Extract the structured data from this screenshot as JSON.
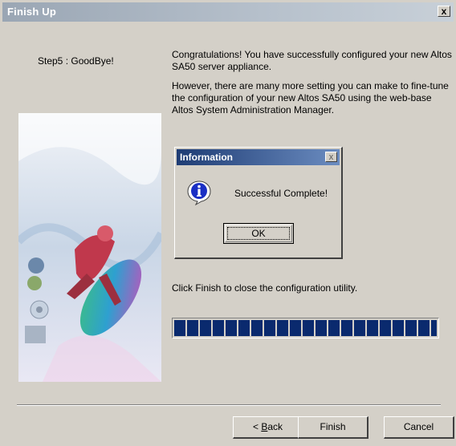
{
  "window": {
    "title": "Finish Up",
    "close_label": "x"
  },
  "wizard": {
    "step_label": "Step5 : GoodBye!",
    "paragraph1": "Congratulations! You have successfully configured your new Altos SA50 server appliance.",
    "paragraph2": "However, there are many more setting you can make to fine-tune the configuration of your new Altos SA50 using the web-base Altos System Administration Manager.",
    "finish_hint": "Click Finish to close the configuration utility.",
    "progress_fraction": 1.0
  },
  "dialog": {
    "title": "Information",
    "close_label": "x",
    "message": "Successful Complete!",
    "ok_label": "OK",
    "icon": "info-icon"
  },
  "buttons": {
    "back_prefix": "< ",
    "back_accel": "B",
    "back_rest": "ack",
    "finish": "Finish",
    "cancel": "Cancel"
  },
  "colors": {
    "progress_fill": "#0a2a6e",
    "dialog_title": "#1e3c74",
    "window_bg": "#d4d0c8"
  }
}
